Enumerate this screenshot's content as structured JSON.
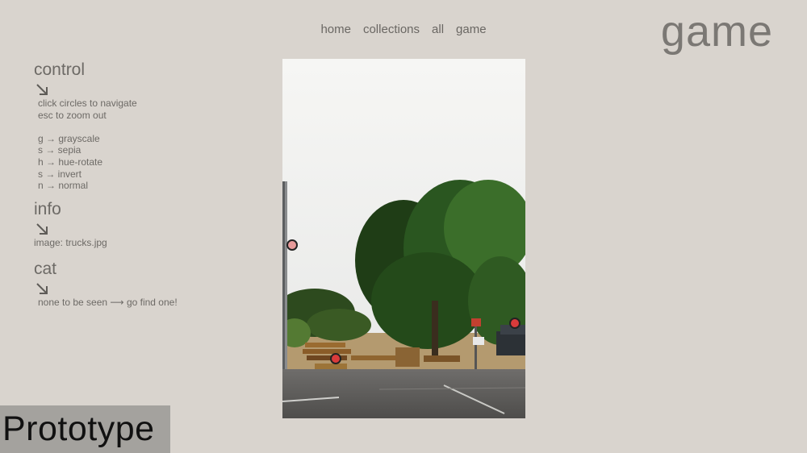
{
  "nav": {
    "home": "home",
    "collections": "collections",
    "all": "all",
    "game": "game"
  },
  "brand": "game",
  "control": {
    "title": "control",
    "lines": [
      "click circles to navigate",
      "esc to zoom out",
      "g → grayscale",
      "s → sepia",
      "h → hue-rotate",
      "s → invert",
      "n → normal"
    ]
  },
  "info": {
    "title": "info",
    "image_line": "image: trucks.jpg"
  },
  "cat": {
    "title": "cat",
    "line": "none to be seen ⟶ go find one!"
  },
  "badge": "Prototype",
  "icons": [
    "arrow-down-right-icon"
  ],
  "colors": {
    "background": "#d9d4ce",
    "hotspot_light": "#e79a9a",
    "hotspot_red": "#d93b3b",
    "badge": "#a4a29e"
  }
}
